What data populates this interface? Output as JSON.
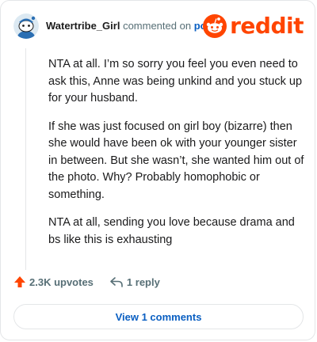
{
  "header": {
    "username": "Watertribe_Girl",
    "commented_text": "commented on",
    "post_link": "post",
    "brand": "reddit"
  },
  "comment": {
    "paragraphs": [
      "NTA at all. I’m so sorry you feel you even need to ask this, Anne was being unkind and you stuck up for your husband.",
      "If she was just focused on girl boy (bizarre) then she would have been ok with your younger sister in between. But she wasn’t, she wanted him out of the photo. Why? Probably homophobic or something.",
      "NTA at all, sending you love because drama and bs like this is exhausting"
    ]
  },
  "actions": {
    "upvotes": "2.3K upvotes",
    "replies": "1 reply"
  },
  "footer": {
    "view_comments": "View 1 comments"
  },
  "colors": {
    "brand": "#ff4500",
    "link": "#0a5fc2",
    "muted": "#576f76"
  },
  "icons": {
    "avatar": "snoo-avatar-icon",
    "logo": "reddit-snoo-icon",
    "upvote": "upvote-arrow-icon",
    "reply": "reply-arrow-icon"
  }
}
